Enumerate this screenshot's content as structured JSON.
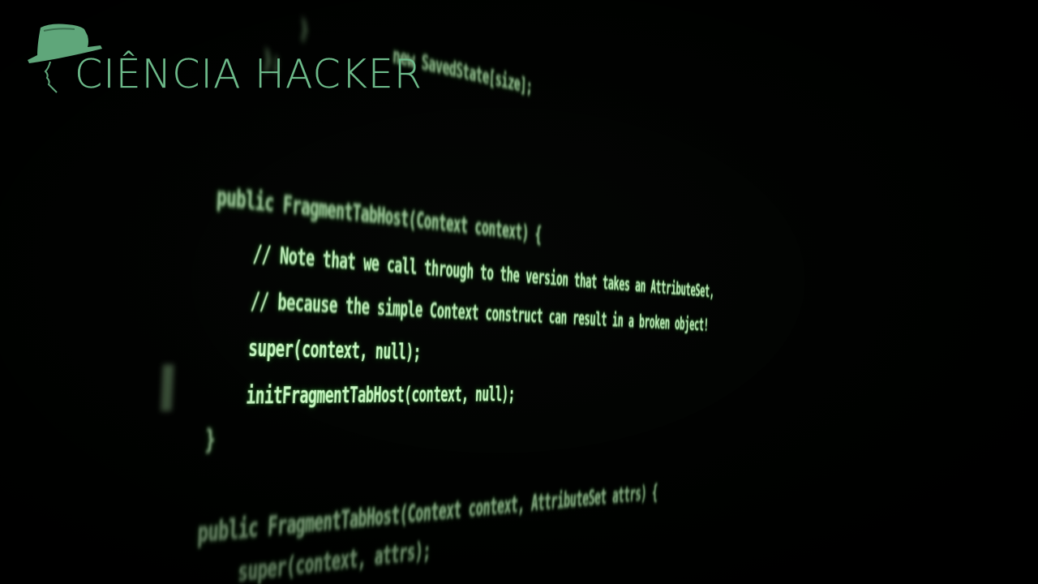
{
  "logo": {
    "icon": "hacker-hat-profile-icon",
    "text": "CIÊNCIA HACKER",
    "color": "#6dba8a"
  },
  "code": {
    "glow_color": "#c9f7c4",
    "lines": [
      "}",
      "new SavedState[size];",
      "};",
      "public FragmentTabHost(Context context) {",
      "// Note that we call through to the version that takes an AttributeSet,",
      "// because the simple Context construct can result in a broken object!",
      "super(context, null);",
      "initFragmentTabHost(context, null);",
      "}",
      "public FragmentTabHost(Context context, AttributeSet attrs) {",
      "super(context, attrs);"
    ]
  }
}
